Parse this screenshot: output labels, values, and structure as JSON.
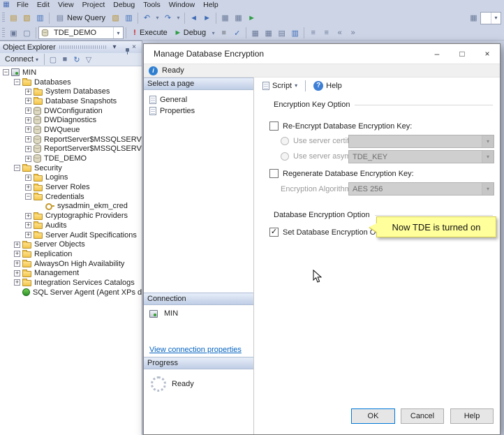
{
  "menu": {
    "items": [
      "File",
      "Edit",
      "View",
      "Project",
      "Debug",
      "Tools",
      "Window",
      "Help"
    ]
  },
  "toolbar1": {
    "new_query": "New Query"
  },
  "toolbar2": {
    "database": "TDE_DEMO",
    "execute": "Execute",
    "debug": "Debug"
  },
  "object_explorer": {
    "title": "Object Explorer",
    "connect": "Connect",
    "tree": [
      {
        "label": "MIN",
        "level": 0,
        "exp": "minus",
        "icon": "server"
      },
      {
        "label": "Databases",
        "level": 1,
        "exp": "minus",
        "icon": "folder"
      },
      {
        "label": "System Databases",
        "level": 2,
        "exp": "plus",
        "icon": "folder"
      },
      {
        "label": "Database Snapshots",
        "level": 2,
        "exp": "plus",
        "icon": "folder"
      },
      {
        "label": "DWConfiguration",
        "level": 2,
        "exp": "plus",
        "icon": "db"
      },
      {
        "label": "DWDiagnostics",
        "level": 2,
        "exp": "plus",
        "icon": "db"
      },
      {
        "label": "DWQueue",
        "level": 2,
        "exp": "plus",
        "icon": "db"
      },
      {
        "label": "ReportServer$MSSQLSERVER",
        "level": 2,
        "exp": "plus",
        "icon": "db"
      },
      {
        "label": "ReportServer$MSSQLSERVER",
        "level": 2,
        "exp": "plus",
        "icon": "db"
      },
      {
        "label": "TDE_DEMO",
        "level": 2,
        "exp": "plus",
        "icon": "db"
      },
      {
        "label": "Security",
        "level": 1,
        "exp": "minus",
        "icon": "folder"
      },
      {
        "label": "Logins",
        "level": 2,
        "exp": "plus",
        "icon": "folder"
      },
      {
        "label": "Server Roles",
        "level": 2,
        "exp": "plus",
        "icon": "folder"
      },
      {
        "label": "Credentials",
        "level": 2,
        "exp": "minus",
        "icon": "folder"
      },
      {
        "label": "sysadmin_ekm_cred",
        "level": 3,
        "exp": null,
        "icon": "key"
      },
      {
        "label": "Cryptographic Providers",
        "level": 2,
        "exp": "plus",
        "icon": "folder"
      },
      {
        "label": "Audits",
        "level": 2,
        "exp": "plus",
        "icon": "folder"
      },
      {
        "label": "Server Audit Specifications",
        "level": 2,
        "exp": "plus",
        "icon": "folder"
      },
      {
        "label": "Server Objects",
        "level": 1,
        "exp": "plus",
        "icon": "folder"
      },
      {
        "label": "Replication",
        "level": 1,
        "exp": "plus",
        "icon": "folder"
      },
      {
        "label": "AlwaysOn High Availability",
        "level": 1,
        "exp": "plus",
        "icon": "folder"
      },
      {
        "label": "Management",
        "level": 1,
        "exp": "plus",
        "icon": "folder"
      },
      {
        "label": "Integration Services Catalogs",
        "level": 1,
        "exp": "plus",
        "icon": "folder"
      },
      {
        "label": "SQL Server Agent (Agent XPs disabl",
        "level": 1,
        "exp": null,
        "icon": "agent"
      }
    ]
  },
  "dialog": {
    "title": "Manage Database Encryption",
    "status": "Ready",
    "select_page": {
      "header": "Select a page",
      "items": [
        "General",
        "Properties"
      ]
    },
    "toolbar": {
      "script": "Script",
      "help": "Help"
    },
    "content": {
      "group1": "Encryption Key Option",
      "re_encrypt": "Re-Encrypt Database Encryption Key:",
      "use_cert": "Use server certificate:",
      "use_asym": "Use server asymmetric key:",
      "asym_value": "TDE_KEY",
      "regenerate": "Regenerate Database Encryption Key:",
      "algorithm_label": "Encryption Algorithm:",
      "algorithm_value": "AES 256",
      "group2": "Database Encryption Option",
      "set_encryption": "Set Database Encryption On",
      "callout": "Now TDE is turned on"
    },
    "connection": {
      "header": "Connection",
      "server": "MIN",
      "link": "View connection properties"
    },
    "progress": {
      "header": "Progress",
      "status": "Ready"
    },
    "buttons": {
      "ok": "OK",
      "cancel": "Cancel",
      "help": "Help"
    }
  },
  "colors": {
    "callout_bg": "#ffff9c",
    "accent": "#0078d7"
  },
  "icons": {
    "app": "▦",
    "new_file": "▤",
    "open": "▧",
    "save": "▥",
    "undo": "↶",
    "redo": "↷",
    "dropdown": "▾",
    "back": "◄",
    "forward": "►",
    "play": "►",
    "list": "▦",
    "exec_bang": "!",
    "stop": "■",
    "check": "✓",
    "grid": "▦",
    "text_results": "▤",
    "comment": "≡",
    "indent_dec": "«",
    "indent_inc": "»",
    "connect_db": "▣",
    "change_conn": "▢",
    "panel_menu": "▾",
    "close": "×",
    "minimize": "–",
    "maximize": "□",
    "info": "i",
    "help": "?",
    "refresh": "↻",
    "filter": "▽",
    "checkmark": "✓"
  }
}
